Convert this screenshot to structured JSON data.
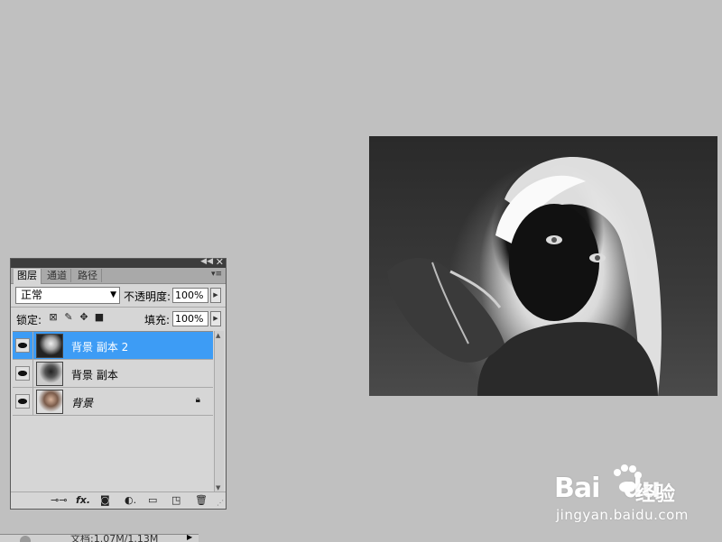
{
  "panel": {
    "tabs": [
      "图层",
      "通道",
      "路径"
    ],
    "blend_mode": "正常",
    "opacity_label": "不透明度:",
    "opacity_value": "100%",
    "lock_label": "锁定:",
    "fill_label": "填充:",
    "fill_value": "100%",
    "layers": [
      {
        "name": "背景 副本 2",
        "selected": true
      },
      {
        "name": "背景 副本",
        "selected": false
      },
      {
        "name": "背景",
        "selected": false,
        "locked": true
      }
    ],
    "footer_icons": [
      "link-icon",
      "fx-icon",
      "mask-icon",
      "adjustment-icon",
      "group-folder-icon",
      "new-layer-icon",
      "trash-icon"
    ]
  },
  "status": {
    "doc_text": "文档:1.07M/1.13M"
  },
  "watermark": {
    "brand": "Bai",
    "brand2": "du",
    "cn": "经验",
    "url": "jingyan.baidu.com"
  }
}
